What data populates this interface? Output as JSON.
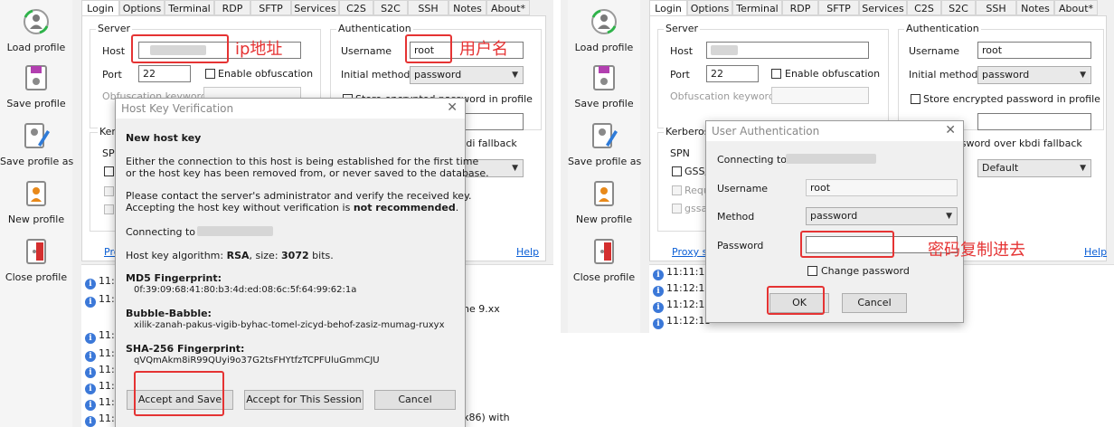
{
  "sidebar": {
    "items": [
      {
        "label": "Load profile",
        "icon": "load-profile-icon"
      },
      {
        "label": "Save profile",
        "icon": "save-profile-icon"
      },
      {
        "label": "Save profile as",
        "icon": "save-profile-as-icon"
      },
      {
        "label": "New profile",
        "icon": "new-profile-icon"
      },
      {
        "label": "Close profile",
        "icon": "close-profile-icon"
      }
    ]
  },
  "tabs": [
    "Login",
    "Options",
    "Terminal",
    "RDP",
    "SFTP",
    "Services",
    "C2S",
    "S2C",
    "SSH",
    "Notes",
    "About*"
  ],
  "login": {
    "server_title": "Server",
    "host_label": "Host",
    "port_label": "Port",
    "port_value": "22",
    "obfuscation_label": "Enable obfuscation",
    "obfuscation_keyword_label": "Obfuscation keyword",
    "auth_title": "Authentication",
    "username_label": "Username",
    "username_value": "root",
    "initial_method_label": "Initial method",
    "initial_method_value": "password",
    "store_password_label": "Store encrypted password in profile",
    "store_password_partial": "Store encrypted password in profile",
    "kerberos_title": "Kerberos",
    "kerberos_partial": "Kerb",
    "spn_label": "SPN",
    "spn_partial": "SPN",
    "gss_label": "GSS/I",
    "requ_label": "Requ",
    "gssapi_label": "gssap",
    "kbdi_fallback_label": "kdi fallback",
    "kbdi_fallback_label_full": "ssword over kbdi fallback",
    "default_value": "Default",
    "proxy_label": "Pro",
    "proxy_label_full": "Proxy se",
    "help_label": "Help",
    "password_partial": "Password"
  },
  "annotations": {
    "ip": "ip地址",
    "user": "用户名",
    "pwd": "密码复制进去"
  },
  "host_key_dialog": {
    "title": "Host Key Verification",
    "heading": "New host key",
    "p1_line1": "Either the connection to this host is being established for the first time",
    "p1_line2": "or the host key has been removed from, or never saved to the database.",
    "p2_line1": "Please contact the server's administrator and verify the received key.",
    "p2_line2_a": "Accepting the host key without verification is ",
    "p2_line2_b": "not recommended",
    "p2_line2_c": ".",
    "connecting_to": "Connecting to ",
    "connecting_to_first": "1",
    "algo_prefix": "Host key algorithm: ",
    "algo_name": "RSA",
    "algo_mid": ", size: ",
    "algo_size": "3072",
    "algo_suffix": " bits.",
    "md5_label": "MD5 Fingerprint:",
    "md5_value": "0f:39:09:68:41:80:b3:4d:ed:08:6c:5f:64:99:62:1a",
    "bubble_label": "Bubble-Babble:",
    "bubble_value": "xilik-zanah-pakus-vigib-byhac-tomel-zicyd-behof-zasiz-mumag-ruxyx",
    "sha_label": "SHA-256 Fingerprint:",
    "sha_value": "qVQmAkm8iR99QUyi9o37G2tsFHYtfzTCPFUluGmmCJU",
    "accept_save": "Accept and Save",
    "accept_session": "Accept for This Session",
    "cancel": "Cancel"
  },
  "auth_dialog": {
    "title": "User Authentication",
    "connecting_to": "Connecting to:",
    "username_label": "Username",
    "username_value": "root",
    "method_label": "Method",
    "method_value": "password",
    "password_label": "Password",
    "change_password": "Change password",
    "ok": "OK",
    "cancel": "Cancel"
  },
  "log_left": {
    "rows": [
      "11:",
      "11:",
      "11:",
      "11:",
      "11:",
      "11:",
      "11:",
      "11:",
      "11:",
      "11:"
    ],
    "fragments": [
      "ne 9.xx",
      "x86) with"
    ]
  },
  "log_right": {
    "rows": [
      "11:11:10",
      "11:12:13",
      "11:12:13",
      "11:12:13",
      "11:12:13"
    ]
  },
  "colors": {
    "annotation": "#e53333",
    "link": "#0b5fd6"
  }
}
